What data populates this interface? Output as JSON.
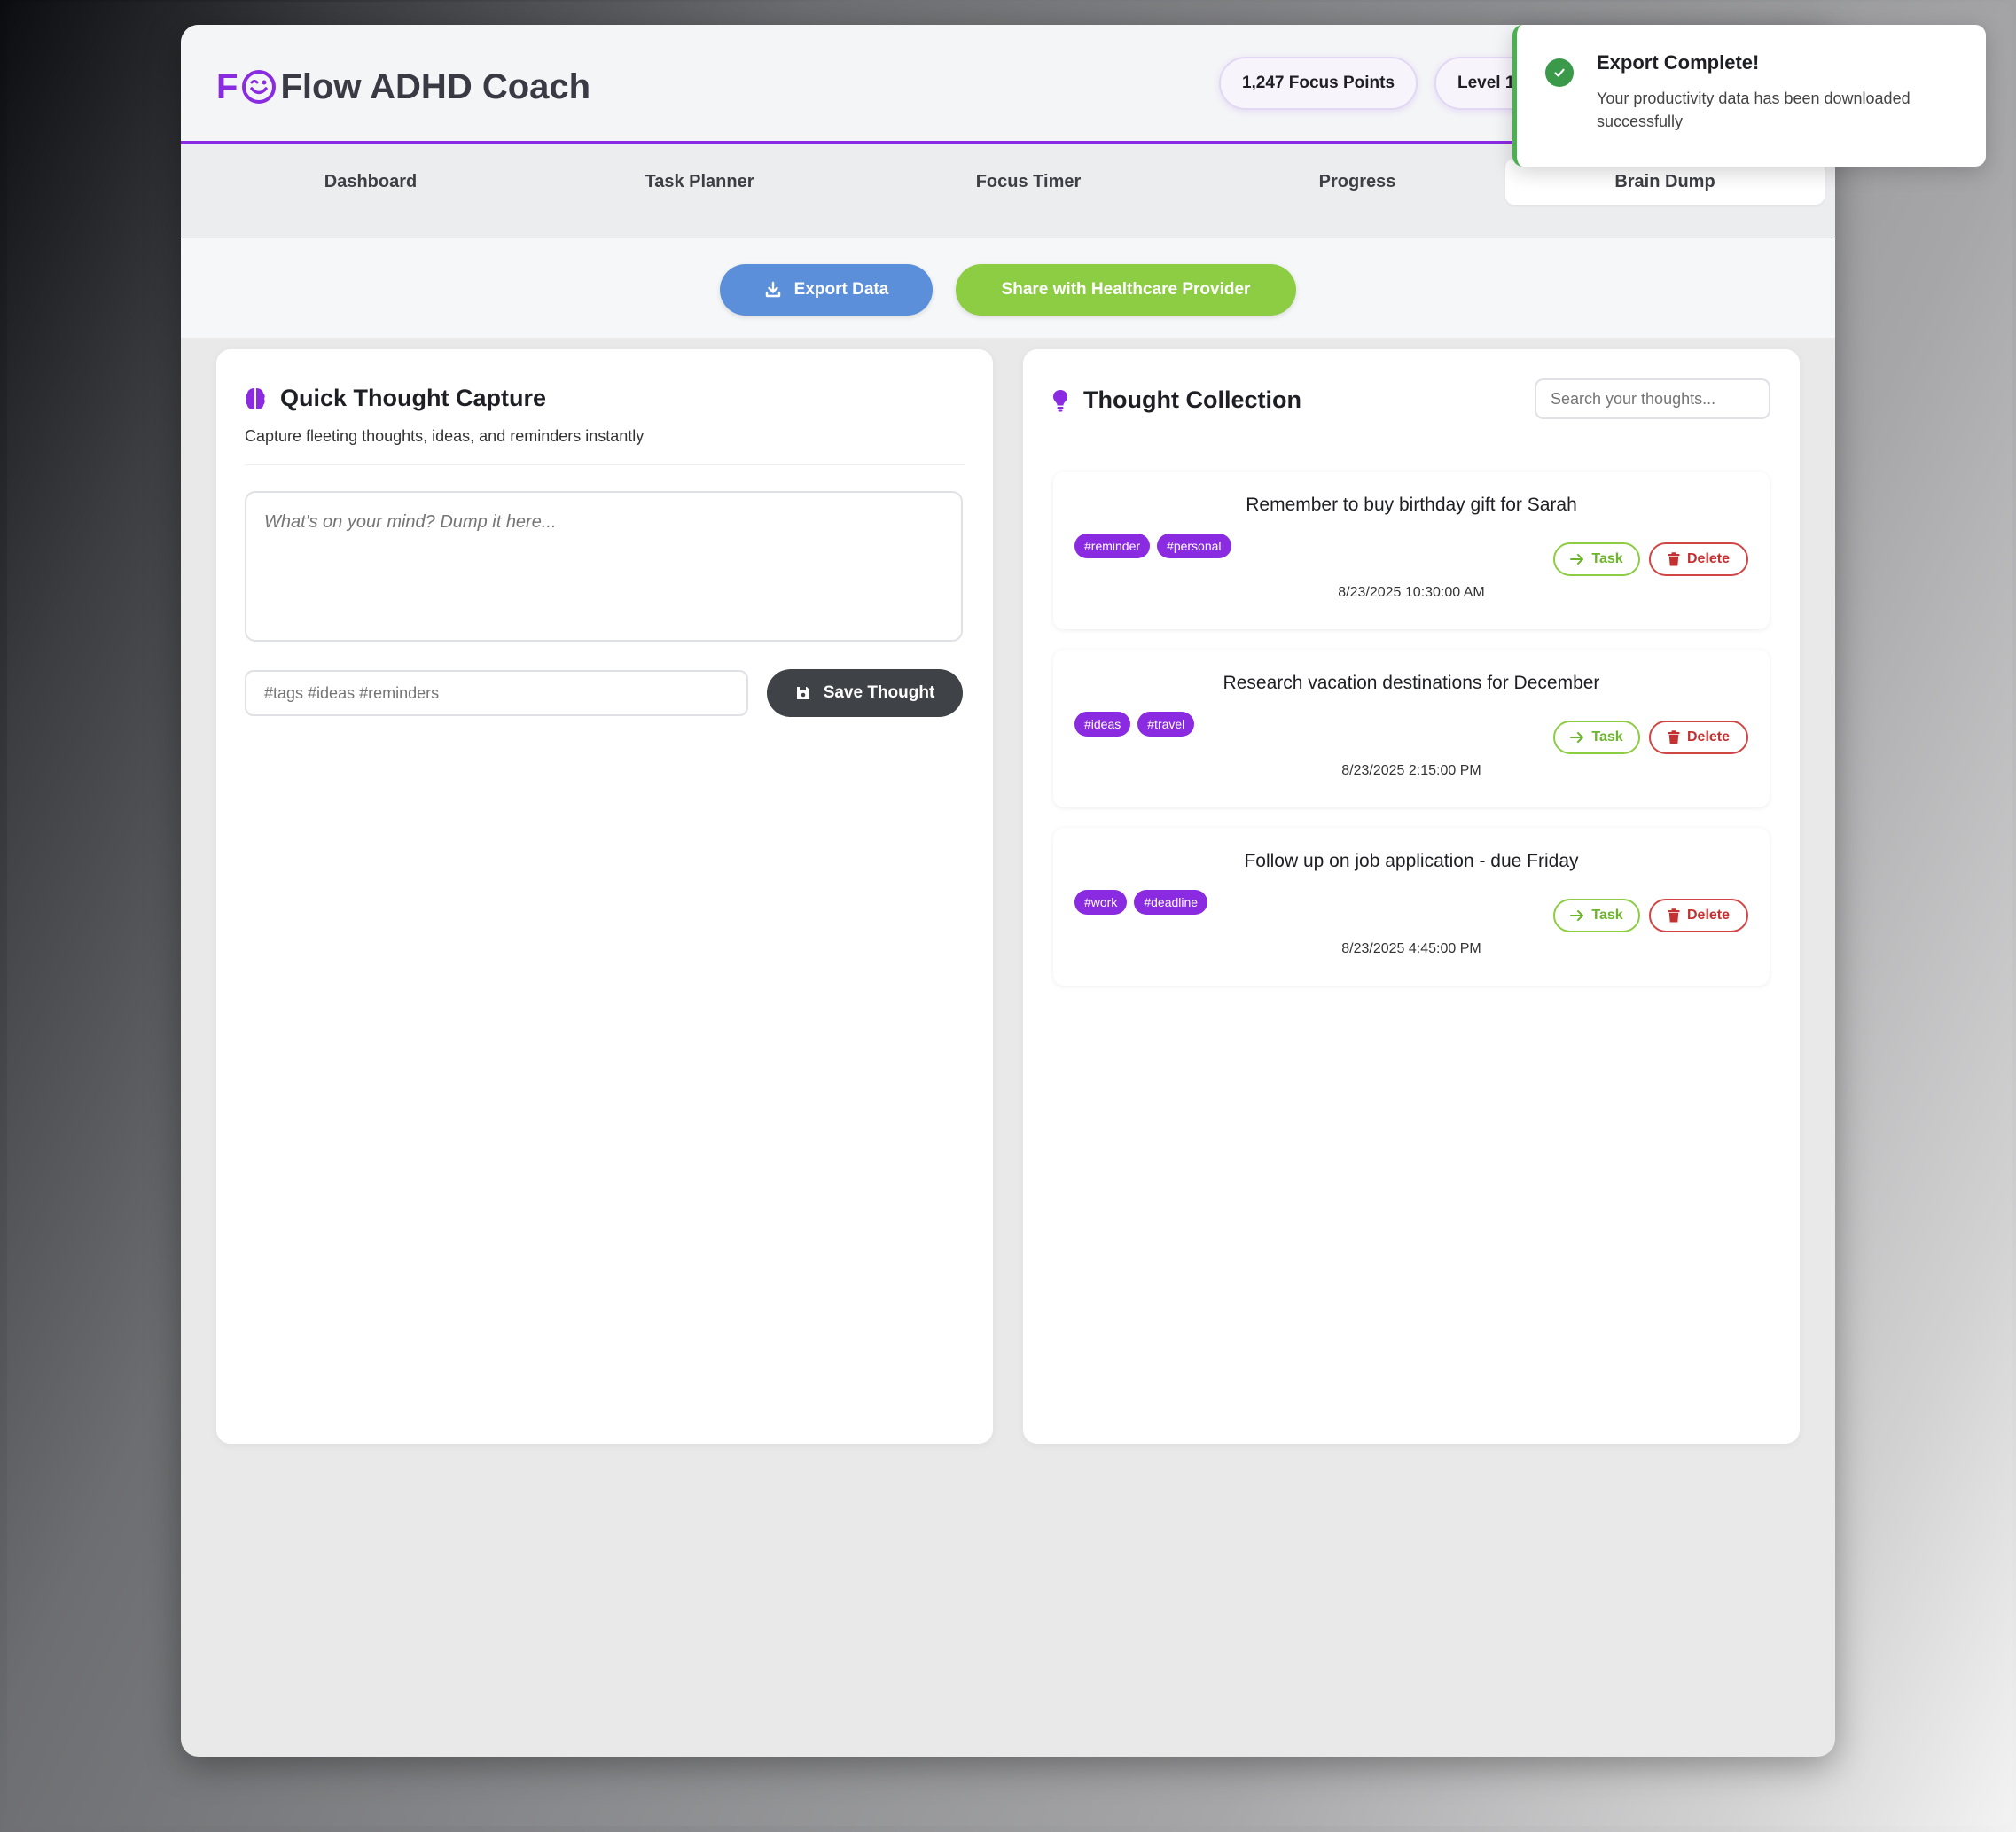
{
  "app": {
    "logo_letter": "F",
    "title": "Flow ADHD Coach",
    "brand_color": "#8a2be2"
  },
  "header": {
    "focus_points": "1,247 Focus Points",
    "level": "Level 1"
  },
  "tabs": [
    {
      "label": "Dashboard",
      "active": false
    },
    {
      "label": "Task Planner",
      "active": false
    },
    {
      "label": "Focus Timer",
      "active": false
    },
    {
      "label": "Progress",
      "active": false
    },
    {
      "label": "Brain Dump",
      "active": true
    }
  ],
  "actions": {
    "export_label": "Export Data",
    "export_icon": "download-icon",
    "share_label": "Share with Healthcare Provider"
  },
  "capture": {
    "icon": "brain-icon",
    "title": "Quick Thought Capture",
    "subtitle": "Capture fleeting thoughts, ideas, and reminders instantly",
    "thought_placeholder": "What's on your mind? Dump it here...",
    "thought_value": "",
    "tags_placeholder": "#tags #ideas #reminders",
    "tags_value": "",
    "save_label": "Save Thought",
    "save_icon": "save-icon"
  },
  "collection": {
    "icon": "lightbulb-icon",
    "title": "Thought Collection",
    "search_placeholder": "Search your thoughts...",
    "items": [
      {
        "text": "Remember to buy birthday gift for Sarah",
        "tags": [
          "#reminder",
          "#personal"
        ],
        "task_label": "Task",
        "delete_label": "Delete",
        "timestamp": "8/23/2025 10:30:00 AM"
      },
      {
        "text": "Research vacation destinations for December",
        "tags": [
          "#ideas",
          "#travel"
        ],
        "task_label": "Task",
        "delete_label": "Delete",
        "timestamp": "8/23/2025 2:15:00 PM"
      },
      {
        "text": "Follow up on job application - due Friday",
        "tags": [
          "#work",
          "#deadline"
        ],
        "task_label": "Task",
        "delete_label": "Delete",
        "timestamp": "8/23/2025 4:45:00 PM"
      }
    ]
  },
  "toast": {
    "icon": "check-circle-icon",
    "title": "Export Complete!",
    "message": "Your productivity data has been downloaded successfully",
    "accent": "#4caf50"
  },
  "colors": {
    "export_button": "#5b8fd9",
    "share_button": "#8ccd44",
    "save_button": "#3f4246",
    "tag": "#8a2be2",
    "delete": "#c53030",
    "task": "#6bb52a"
  }
}
